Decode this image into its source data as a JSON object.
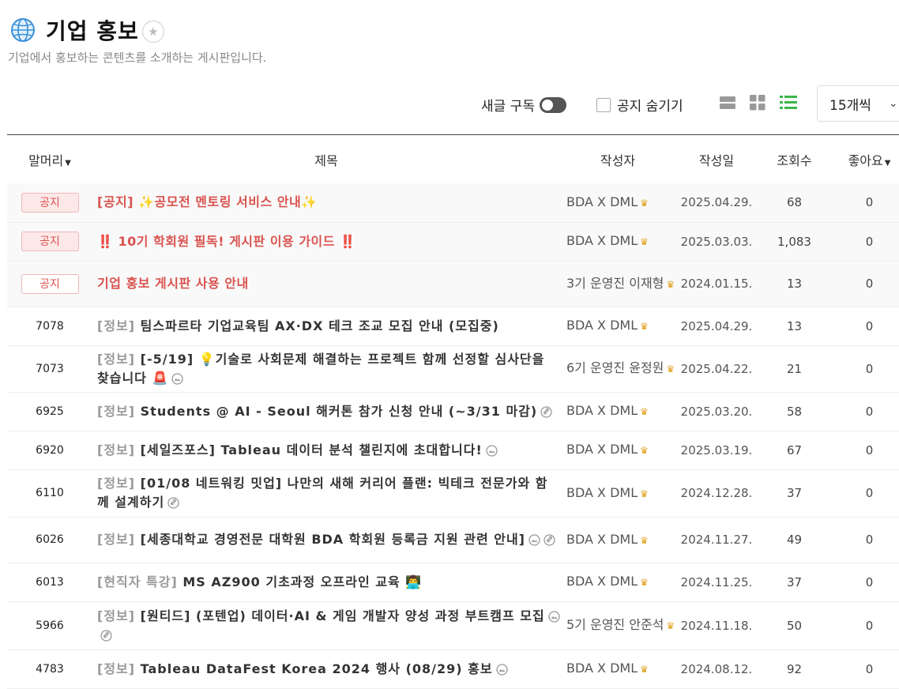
{
  "page": {
    "title": "기업 홍보",
    "subtitle": "기업에서 홍보하는 콘텐츠를 소개하는 게시판입니다."
  },
  "toolbar": {
    "subscribe_label": "새글 구독",
    "hide_notice_label": "공지 숨기기",
    "per_page": "15개씩"
  },
  "table": {
    "headers": {
      "category": "말머리",
      "title": "제목",
      "author": "작성자",
      "date": "작성일",
      "views": "조회수",
      "likes": "좋아요"
    },
    "rows": [
      {
        "num": "공지",
        "badge": "filled",
        "cat": "",
        "title": "[공지] ✨공모전 멘토링 서비스 안내✨",
        "notice": true,
        "author": "BDA X DML",
        "date": "2025.04.29.",
        "views": "68",
        "likes": "0"
      },
      {
        "num": "공지",
        "badge": "filled",
        "cat": "",
        "title": "‼️ 10기 학회원 필독! 게시판 이용 가이드 ‼️",
        "notice": true,
        "author": "BDA X DML",
        "date": "2025.03.03.",
        "views": "1,083",
        "likes": "0"
      },
      {
        "num": "공지",
        "badge": "plain",
        "cat": "",
        "title": "기업 홍보 게시판 사용 안내",
        "notice": true,
        "author": "3기 운영진 이재형",
        "date": "2024.01.15.",
        "views": "13",
        "likes": "0"
      },
      {
        "num": "7078",
        "cat": "[정보]",
        "title": "팀스파르타 기업교육팀 AX·DX 테크 조교 모집 안내 (모집중)",
        "author": "BDA X DML",
        "date": "2025.04.29.",
        "views": "13",
        "likes": "0"
      },
      {
        "num": "7073",
        "cat": "[정보]",
        "title": "[-5/19] 💡기술로 사회문제 해결하는 프로젝트 함께 선정할 심사단을 찾습니다 🚨",
        "icons": "img",
        "author": "6기 운영진 윤정원",
        "date": "2025.04.22.",
        "views": "21",
        "likes": "0"
      },
      {
        "num": "6925",
        "cat": "[정보]",
        "title": "Students @ AI - Seoul 해커톤 참가 신청 안내 (~3/31 마감)",
        "icons": "link",
        "author": "BDA X DML",
        "date": "2025.03.20.",
        "views": "58",
        "likes": "0"
      },
      {
        "num": "6920",
        "cat": "[정보]",
        "title": "[세일즈포스] Tableau 데이터 분석 챌린지에 초대합니다!",
        "icons": "img",
        "author": "BDA X DML",
        "date": "2025.03.19.",
        "views": "67",
        "likes": "0"
      },
      {
        "num": "6110",
        "cat": "[정보]",
        "title": "[01/08 네트워킹 밋업] 나만의 새해 커리어 플랜: 빅테크 전문가와 함께 설계하기",
        "icons": "link",
        "author": "BDA X DML",
        "date": "2024.12.28.",
        "views": "37",
        "likes": "0"
      },
      {
        "num": "6026",
        "cat": "[정보]",
        "title": "[세종대학교 경영전문 대학원 BDA 학회원 등록금 지원 관련 안내]",
        "icons": "img-link",
        "author": "BDA X DML",
        "date": "2024.11.27.",
        "views": "49",
        "likes": "0"
      },
      {
        "num": "6013",
        "cat": "[현직자 특강]",
        "title": "MS AZ900 기초과정 오프라인 교육 👨‍💻",
        "author": "BDA X DML",
        "date": "2024.11.25.",
        "views": "37",
        "likes": "0"
      },
      {
        "num": "5966",
        "cat": "[정보]",
        "title": "[원티드] (포텐업) 데이터·AI & 게임 개발자 양성 과정 부트캠프 모집",
        "icons": "img-link",
        "author": "5기 운영진 안준석",
        "date": "2024.11.18.",
        "views": "50",
        "likes": "0"
      },
      {
        "num": "4783",
        "cat": "[정보]",
        "title": "Tableau DataFest Korea 2024 행사 (08/29) 홍보",
        "icons": "img",
        "author": "BDA X DML",
        "date": "2024.08.12.",
        "views": "92",
        "likes": "0"
      }
    ]
  }
}
